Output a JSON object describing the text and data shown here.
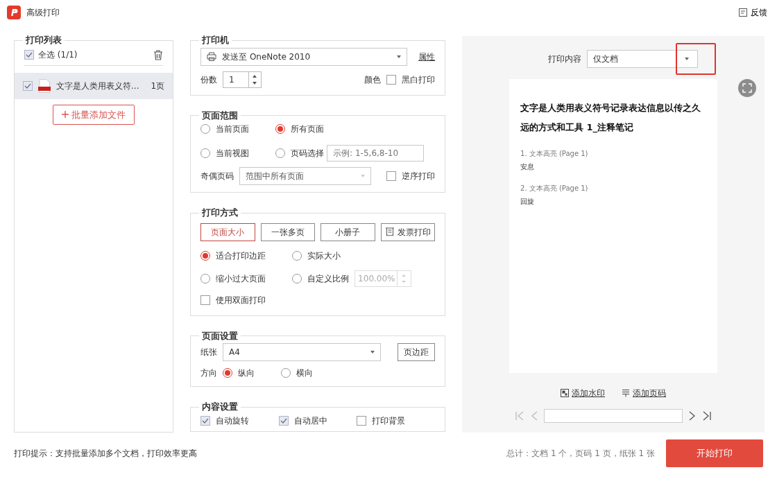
{
  "window": {
    "title": "高级打印",
    "feedback": "反馈"
  },
  "print_list": {
    "title": "打印列表",
    "select_all": {
      "label": "全选 (1/1)",
      "checked": true
    },
    "files": [
      {
        "name": "文字是人类用表义符...",
        "pages": "1页",
        "checked": true,
        "selected": true
      }
    ],
    "add_button": "批量添加文件"
  },
  "printer": {
    "title": "打印机",
    "name": "发送至 OneNote 2010",
    "properties_link": "属性",
    "copies_label": "份数",
    "copies": "1",
    "color_label": "颜色",
    "mono": {
      "label": "黑白打印",
      "checked": false
    }
  },
  "page_range": {
    "title": "页面范围",
    "options": [
      {
        "label": "当前页面",
        "selected": false
      },
      {
        "label": "所有页面",
        "selected": true
      },
      {
        "label": "当前视图",
        "selected": false
      },
      {
        "label": "页码选择",
        "selected": false
      }
    ],
    "page_select_placeholder": "示例: 1-5,6,8-10",
    "odd_even_label": "奇偶页码",
    "odd_even_value": "范围中所有页面",
    "reverse": {
      "label": "逆序打印",
      "checked": false
    }
  },
  "print_mode": {
    "title": "打印方式",
    "tabs": [
      {
        "label": "页面大小",
        "selected": true,
        "kind": "plain"
      },
      {
        "label": "一张多页",
        "selected": false,
        "kind": "plain"
      },
      {
        "label": "小册子",
        "selected": false,
        "kind": "plain"
      },
      {
        "label": "发票打印",
        "selected": false,
        "kind": "invoice"
      }
    ],
    "scale_options": [
      {
        "label": "适合打印边距",
        "selected": true
      },
      {
        "label": "实际大小",
        "selected": false
      },
      {
        "label": "缩小过大页面",
        "selected": false
      },
      {
        "label": "自定义比例",
        "selected": false
      }
    ],
    "scale_value": "100.00%",
    "duplex": {
      "label": "使用双面打印",
      "checked": false
    }
  },
  "page_setup": {
    "title": "页面设置",
    "paper_label": "纸张",
    "paper": "A4",
    "margins_button": "页边距",
    "orientation_label": "方向",
    "orientations": [
      {
        "label": "纵向",
        "selected": true
      },
      {
        "label": "横向",
        "selected": false
      }
    ]
  },
  "content_settings": {
    "title": "内容设置",
    "options": [
      {
        "label": "自动旋转",
        "checked": true
      },
      {
        "label": "自动居中",
        "checked": true
      },
      {
        "label": "打印背景",
        "checked": false
      }
    ]
  },
  "preview": {
    "content_label": "打印内容",
    "content_value": "仅文档",
    "page": {
      "title": "文字是人类用表义符号记录表达信息以传之久远的方式和工具 1_注释笔记",
      "notes": [
        {
          "heading": "1. 文本高亮 (Page 1)",
          "text": "安息"
        },
        {
          "heading": "2. 文本高亮 (Page 1)",
          "text": "回旋"
        }
      ]
    },
    "add_watermark": "添加水印",
    "add_page_number": "添加页码"
  },
  "footer": {
    "hint": "打印提示：支持批量添加多个文档，打印效率更高",
    "summary": "总计：文档 1 个，页码 1 页，纸张 1 张",
    "print_button": "开始打印"
  }
}
